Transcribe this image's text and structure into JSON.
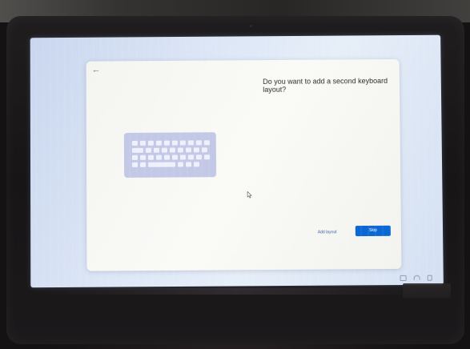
{
  "dialog": {
    "back_icon": "←",
    "question": "Do you want to add a second keyboard layout?",
    "add_layout_label": "Add layout",
    "skip_label": "Skip",
    "accent_color": "#0b67d3"
  },
  "illustration": {
    "icon": "keyboard-icon"
  },
  "taskbar": {
    "icons": [
      "network-icon",
      "wifi-icon",
      "volume-icon"
    ]
  }
}
